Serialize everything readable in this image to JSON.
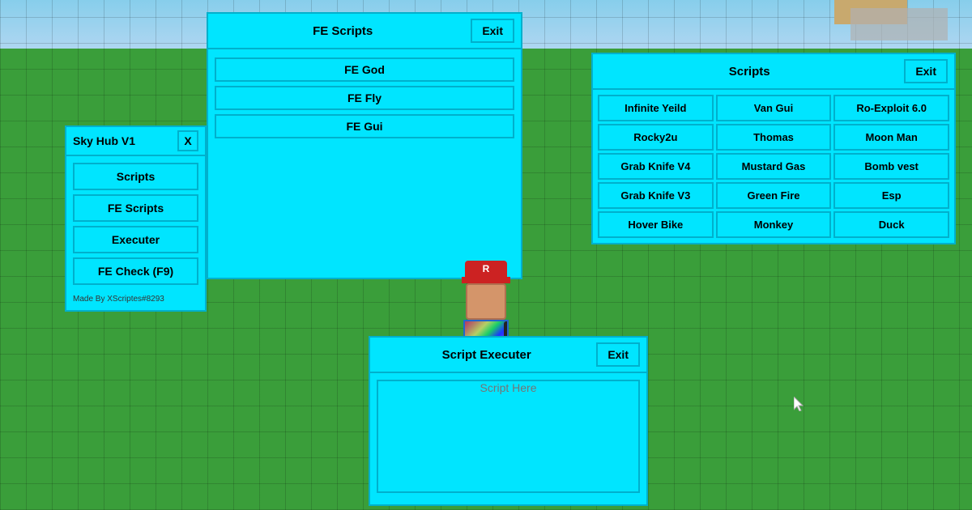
{
  "background": {
    "sky_color": "#87ceeb",
    "ground_color": "#3a9e3a"
  },
  "skyhub": {
    "title": "Sky Hub V1",
    "close_label": "X",
    "buttons": [
      "Scripts",
      "FE Scripts",
      "Executer",
      "FE Check (F9)"
    ],
    "footer": "Made By XScriptes#8293"
  },
  "fe_scripts_panel": {
    "title": "FE Scripts",
    "exit_label": "Exit",
    "buttons": [
      "FE God",
      "FE Fly",
      "FE Gui"
    ]
  },
  "scripts_panel": {
    "title": "Scripts",
    "exit_label": "Exit",
    "items": [
      "Infinite Yeild",
      "Van Gui",
      "Ro-Exploit 6.0",
      "Rocky2u",
      "Thomas",
      "Moon Man",
      "Grab Knife V4",
      "Mustard Gas",
      "Bomb vest",
      "Grab Knife V3",
      "Green Fire",
      "Esp",
      "Hover Bike",
      "Monkey",
      "Duck"
    ]
  },
  "executer_panel": {
    "title": "Script Executer",
    "exit_label": "Exit",
    "placeholder": "Script Here"
  }
}
